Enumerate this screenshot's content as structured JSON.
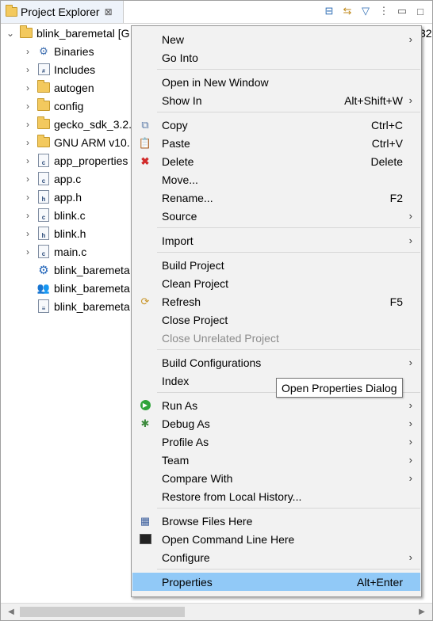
{
  "panel": {
    "title": "Project Explorer",
    "close_symbol": "⊠",
    "toolbar_icons": [
      "collapse-all-icon",
      "link-with-editor-icon",
      "filter-icon",
      "view-menu-icon",
      "minimize-icon",
      "maximize-icon"
    ]
  },
  "tree": {
    "root": {
      "label": "blink_baremetal [G",
      "tail": "32"
    },
    "items": [
      {
        "label": "Binaries",
        "icon": "binaries-icon",
        "expandable": true
      },
      {
        "label": "Includes",
        "icon": "includes-icon",
        "expandable": true
      },
      {
        "label": "autogen",
        "icon": "folder-icon",
        "expandable": true
      },
      {
        "label": "config",
        "icon": "folder-icon",
        "expandable": true
      },
      {
        "label": "gecko_sdk_3.2.",
        "icon": "folder-icon",
        "expandable": true
      },
      {
        "label": "GNU ARM v10.",
        "icon": "folder-icon",
        "expandable": true
      },
      {
        "label": "app_properties",
        "icon": "c-file-icon",
        "expandable": true
      },
      {
        "label": "app.c",
        "icon": "c-file-icon",
        "expandable": true
      },
      {
        "label": "app.h",
        "icon": "h-file-icon",
        "expandable": true
      },
      {
        "label": "blink.c",
        "icon": "c-file-icon",
        "expandable": true
      },
      {
        "label": "blink.h",
        "icon": "h-file-icon",
        "expandable": true
      },
      {
        "label": "main.c",
        "icon": "c-file-icon",
        "expandable": true
      },
      {
        "label": "blink_baremeta",
        "icon": "gear-icon",
        "expandable": false
      },
      {
        "label": "blink_baremeta",
        "icon": "people-icon",
        "expandable": false
      },
      {
        "label": "blink_baremeta",
        "icon": "text-file-icon",
        "expandable": false
      }
    ]
  },
  "context_menu": {
    "groups": [
      [
        {
          "label": "New",
          "submenu": true
        },
        {
          "label": "Go Into"
        }
      ],
      [
        {
          "label": "Open in New Window"
        },
        {
          "label": "Show In",
          "shortcut": "Alt+Shift+W",
          "submenu": true
        }
      ],
      [
        {
          "label": "Copy",
          "shortcut": "Ctrl+C",
          "icon": "copy-icon"
        },
        {
          "label": "Paste",
          "shortcut": "Ctrl+V",
          "icon": "paste-icon"
        },
        {
          "label": "Delete",
          "shortcut": "Delete",
          "icon": "delete-icon"
        },
        {
          "label": "Move..."
        },
        {
          "label": "Rename...",
          "shortcut": "F2"
        },
        {
          "label": "Source",
          "submenu": true
        }
      ],
      [
        {
          "label": "Import",
          "submenu": true
        }
      ],
      [
        {
          "label": "Build Project"
        },
        {
          "label": "Clean Project"
        },
        {
          "label": "Refresh",
          "shortcut": "F5",
          "icon": "refresh-icon"
        },
        {
          "label": "Close Project"
        },
        {
          "label": "Close Unrelated Project",
          "disabled": true
        }
      ],
      [
        {
          "label": "Build Configurations",
          "submenu": true
        },
        {
          "label": "Index"
        }
      ],
      [
        {
          "label": "Run As",
          "submenu": true,
          "icon": "run-icon"
        },
        {
          "label": "Debug As",
          "submenu": true,
          "icon": "debug-icon"
        },
        {
          "label": "Profile As",
          "submenu": true
        },
        {
          "label": "Team",
          "submenu": true
        },
        {
          "label": "Compare With",
          "submenu": true
        },
        {
          "label": "Restore from Local History..."
        }
      ],
      [
        {
          "label": "Browse Files Here",
          "icon": "browse-files-icon"
        },
        {
          "label": "Open Command Line Here",
          "icon": "terminal-icon"
        },
        {
          "label": "Configure",
          "submenu": true
        }
      ],
      [
        {
          "label": "Properties",
          "shortcut": "Alt+Enter",
          "selected": true
        }
      ]
    ]
  },
  "tooltip": {
    "text": "Open Properties Dialog"
  }
}
